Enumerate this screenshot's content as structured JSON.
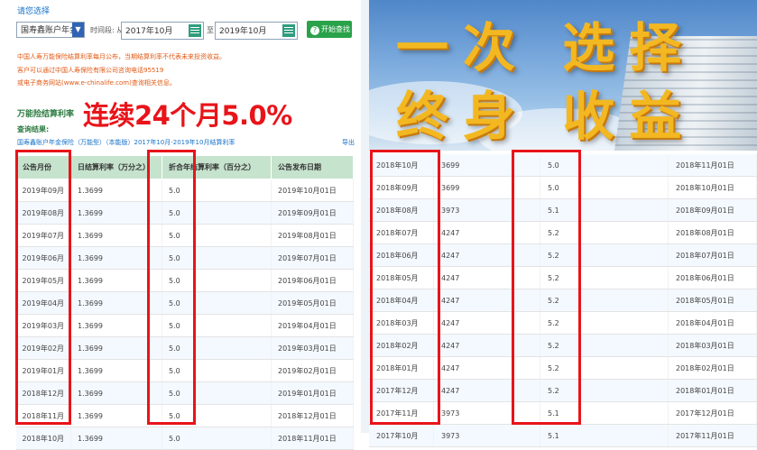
{
  "search": {
    "title": "请您选择",
    "product_select": "国寿鑫账户年金",
    "time_label": "时间段: 从",
    "from_date": "2017年10月",
    "to_label": "至",
    "to_date": "2019年10月",
    "query_button": "开始查找"
  },
  "notices": [
    "中国人寿万能保险结算利率每月公布，当期结算利率不代表未来投资收益。",
    "客户可以通过中国人寿保险有限公司咨询电话95519",
    "或电子商务网站(www.e-chinalife.com)查询相关信息。"
  ],
  "section": {
    "title": "万能险结算利率",
    "result_label": "查询结果:",
    "product_line": "国寿鑫账户年金保险（万能型）（本能版）2017年10月-2019年10月结算利率",
    "export_label": "导出"
  },
  "headline": "连续24个月5.0%",
  "banner": {
    "line1": "一次 选择",
    "line2": "终身 收益"
  },
  "table_headers": [
    "公告月份",
    "日结算利率（万分之）",
    "折合年结算利率（百分之）",
    "公告发布日期"
  ],
  "left_rows": [
    [
      "2019年09月",
      "1.3699",
      "5.0",
      "2019年10月01日"
    ],
    [
      "2019年08月",
      "1.3699",
      "5.0",
      "2019年09月01日"
    ],
    [
      "2019年07月",
      "1.3699",
      "5.0",
      "2019年08月01日"
    ],
    [
      "2019年06月",
      "1.3699",
      "5.0",
      "2019年07月01日"
    ],
    [
      "2019年05月",
      "1.3699",
      "5.0",
      "2019年06月01日"
    ],
    [
      "2019年04月",
      "1.3699",
      "5.0",
      "2019年05月01日"
    ],
    [
      "2019年03月",
      "1.3699",
      "5.0",
      "2019年04月01日"
    ],
    [
      "2019年02月",
      "1.3699",
      "5.0",
      "2019年03月01日"
    ],
    [
      "2019年01月",
      "1.3699",
      "5.0",
      "2019年02月01日"
    ],
    [
      "2018年12月",
      "1.3699",
      "5.0",
      "2019年01月01日"
    ],
    [
      "2018年11月",
      "1.3699",
      "5.0",
      "2018年12月01日"
    ],
    [
      "2018年10月",
      "1.3699",
      "5.0",
      "2018年11月01日"
    ]
  ],
  "right_rows": [
    [
      "2018年10月",
      "3699",
      "5.0",
      "2018年11月01日"
    ],
    [
      "2018年09月",
      "3699",
      "5.0",
      "2018年10月01日"
    ],
    [
      "2018年08月",
      "3973",
      "5.1",
      "2018年09月01日"
    ],
    [
      "2018年07月",
      "4247",
      "5.2",
      "2018年08月01日"
    ],
    [
      "2018年06月",
      "4247",
      "5.2",
      "2018年07月01日"
    ],
    [
      "2018年05月",
      "4247",
      "5.2",
      "2018年06月01日"
    ],
    [
      "2018年04月",
      "4247",
      "5.2",
      "2018年05月01日"
    ],
    [
      "2018年03月",
      "4247",
      "5.2",
      "2018年04月01日"
    ],
    [
      "2018年02月",
      "4247",
      "5.2",
      "2018年03月01日"
    ],
    [
      "2018年01月",
      "4247",
      "5.2",
      "2018年02月01日"
    ],
    [
      "2017年12月",
      "4247",
      "5.2",
      "2018年01月01日"
    ],
    [
      "2017年11月",
      "3973",
      "5.1",
      "2017年12月01日"
    ],
    [
      "2017年10月",
      "3973",
      "5.1",
      "2017年11月01日"
    ]
  ],
  "colors": {
    "highlight": "#e8141a",
    "header_green": "#c6e3cd",
    "button_green": "#29a24a",
    "banner_gold": "#f3b821"
  }
}
